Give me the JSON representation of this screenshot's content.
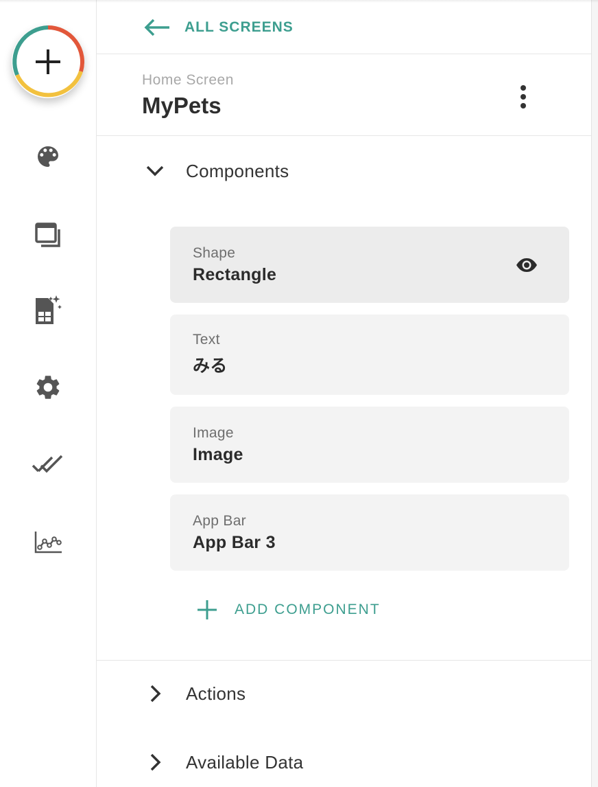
{
  "nav": {
    "back_label": "ALL SCREENS"
  },
  "screen": {
    "subtitle": "Home Screen",
    "title": "MyPets"
  },
  "sections": {
    "components": {
      "title": "Components",
      "expanded": true,
      "items": [
        {
          "type": "Shape",
          "name": "Rectangle",
          "visible_icon": "eye-icon"
        },
        {
          "type": "Text",
          "name": "みる"
        },
        {
          "type": "Image",
          "name": "Image"
        },
        {
          "type": "App Bar",
          "name": "App Bar 3"
        }
      ],
      "add_label": "ADD COMPONENT"
    },
    "actions": {
      "title": "Actions",
      "expanded": false
    },
    "available_data": {
      "title": "Available Data",
      "expanded": false
    }
  },
  "rail": {
    "icons": [
      "add-icon",
      "palette-icon",
      "screens-icon",
      "sheets-data-icon",
      "gear-icon",
      "check-all-icon",
      "analytics-icon"
    ]
  },
  "colors": {
    "accent": "#3d9e8f",
    "ring_red": "#e2573a",
    "ring_yellow": "#f2c13f",
    "ring_teal": "#3d9e8f",
    "card_bg": "#f3f3f3"
  }
}
